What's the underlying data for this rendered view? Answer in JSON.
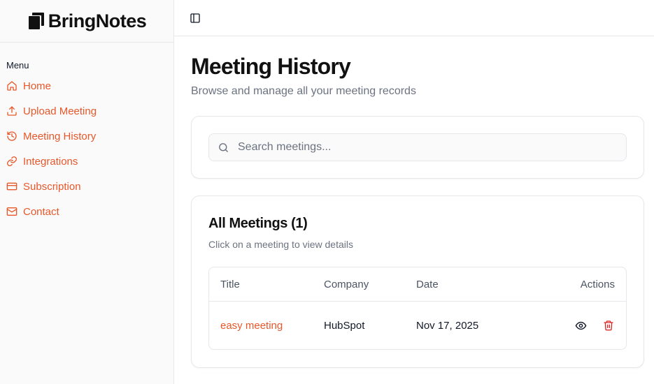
{
  "brand": {
    "name": "BringNotes"
  },
  "sidebar": {
    "menu_label": "Menu",
    "items": [
      {
        "label": "Home",
        "icon": "home-icon"
      },
      {
        "label": "Upload Meeting",
        "icon": "upload-icon"
      },
      {
        "label": "Meeting History",
        "icon": "history-icon"
      },
      {
        "label": "Integrations",
        "icon": "link-icon"
      },
      {
        "label": "Subscription",
        "icon": "credit-card-icon"
      },
      {
        "label": "Contact",
        "icon": "mail-icon"
      }
    ]
  },
  "page": {
    "title": "Meeting History",
    "subtitle": "Browse and manage all your meeting records"
  },
  "search": {
    "placeholder": "Search meetings...",
    "value": ""
  },
  "meetings": {
    "title": "All Meetings (1)",
    "subtitle": "Click on a meeting to view details",
    "columns": {
      "title": "Title",
      "company": "Company",
      "date": "Date",
      "actions": "Actions"
    },
    "rows": [
      {
        "title": "easy meeting",
        "company": "HubSpot",
        "date": "Nov 17, 2025"
      }
    ]
  },
  "colors": {
    "accent": "#e8572a",
    "delete": "#dc2626",
    "muted": "#6b7280",
    "border": "#e5e7eb"
  }
}
